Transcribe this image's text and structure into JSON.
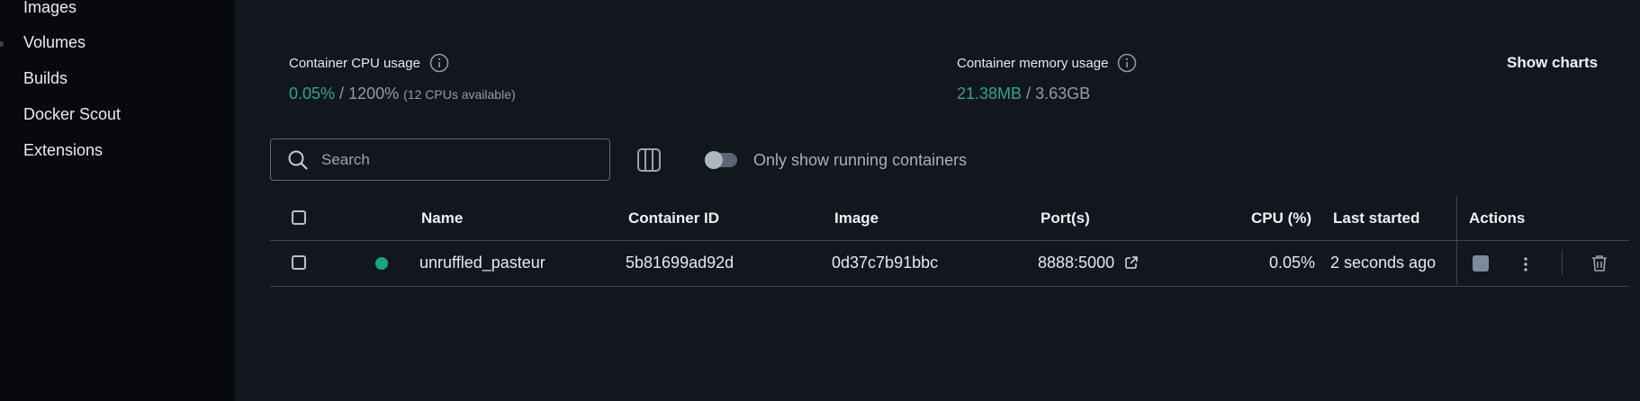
{
  "sidebar": {
    "items": [
      {
        "label": "Images"
      },
      {
        "label": "Volumes"
      },
      {
        "label": "Builds"
      },
      {
        "label": "Docker Scout"
      },
      {
        "label": "Extensions"
      }
    ]
  },
  "stats": {
    "cpu": {
      "label": "Container CPU usage",
      "used": "0.05%",
      "separator": " / ",
      "total": "1200%",
      "note": "(12 CPUs available)"
    },
    "memory": {
      "label": "Container memory usage",
      "used": "21.38MB",
      "separator": " / ",
      "total": "3.63GB"
    },
    "show_charts_label": "Show charts"
  },
  "toolbar": {
    "search_placeholder": "Search",
    "search_value": "",
    "toggle_label": "Only show running containers",
    "toggle_on": false
  },
  "table": {
    "headers": {
      "name": "Name",
      "container_id": "Container ID",
      "image": "Image",
      "ports": "Port(s)",
      "cpu": "CPU (%)",
      "last_started": "Last started",
      "actions": "Actions"
    },
    "rows": [
      {
        "name": "unruffled_pasteur",
        "container_id": "5b81699ad92d",
        "image": "0d37c7b91bbc",
        "ports": "8888:5000",
        "cpu": "0.05%",
        "last_started": "2 seconds ago",
        "status": "running"
      }
    ]
  },
  "colors": {
    "accent_green": "#2ea58f",
    "status_running": "#18a585",
    "background": "#12161d",
    "sidebar_background": "#07090c"
  },
  "icons": [
    "info-icon",
    "search-icon",
    "columns-icon",
    "external-link-icon",
    "stop-icon",
    "more-vertical-icon",
    "trash-icon"
  ]
}
